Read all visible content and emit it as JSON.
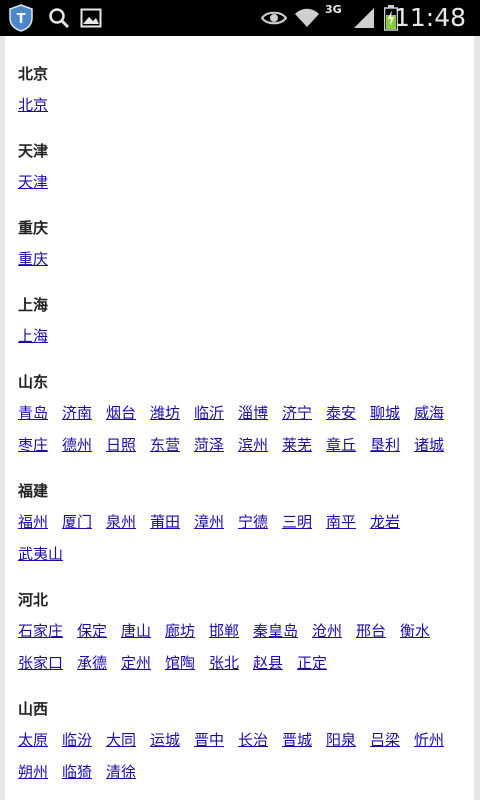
{
  "status_bar": {
    "time": "11:48",
    "network": "3G",
    "icons": [
      "shield-app-icon",
      "search-icon",
      "gallery-icon",
      "eye-icon",
      "wifi-icon",
      "signal-icon",
      "battery-charging-icon"
    ]
  },
  "sections": [
    {
      "title": "北京",
      "rows": [
        [
          "北京"
        ]
      ]
    },
    {
      "title": "天津",
      "rows": [
        [
          "天津"
        ]
      ]
    },
    {
      "title": "重庆",
      "rows": [
        [
          "重庆"
        ]
      ]
    },
    {
      "title": "上海",
      "rows": [
        [
          "上海"
        ]
      ]
    },
    {
      "title": "山东",
      "rows": [
        [
          "青岛",
          "济南",
          "烟台",
          "潍坊",
          "临沂",
          "淄博",
          "济宁",
          "泰安",
          "聊城",
          "威海"
        ],
        [
          "枣庄",
          "德州",
          "日照",
          "东营",
          "菏泽",
          "滨州",
          "莱芜",
          "章丘",
          "垦利",
          "诸城"
        ]
      ]
    },
    {
      "title": "福建",
      "rows": [
        [
          "福州",
          "厦门",
          "泉州",
          "莆田",
          "漳州",
          "宁德",
          "三明",
          "南平",
          "龙岩"
        ],
        [
          "武夷山"
        ]
      ]
    },
    {
      "title": "河北",
      "rows": [
        [
          "石家庄",
          "保定",
          "唐山",
          "廊坊",
          "邯郸",
          "秦皇岛",
          "沧州",
          "邢台",
          "衡水"
        ],
        [
          "张家口",
          "承德",
          "定州",
          "馆陶",
          "张北",
          "赵县",
          "正定"
        ]
      ]
    },
    {
      "title": "山西",
      "rows": [
        [
          "太原",
          "临汾",
          "大同",
          "运城",
          "晋中",
          "长治",
          "晋城",
          "阳泉",
          "吕梁",
          "忻州"
        ],
        [
          "朔州",
          "临猗",
          "清徐"
        ]
      ]
    }
  ]
}
